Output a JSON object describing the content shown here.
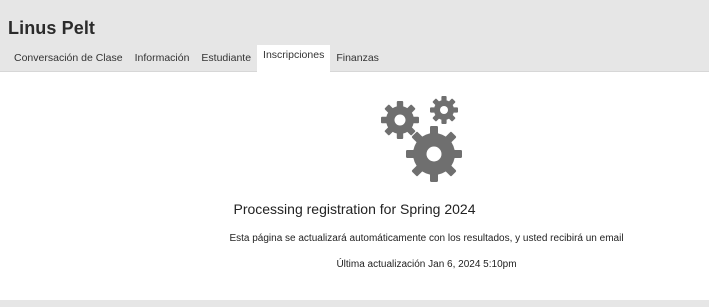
{
  "header": {
    "title": "Linus Pelt"
  },
  "tabs": [
    {
      "label": "Conversación de Clase",
      "active": false
    },
    {
      "label": "Información",
      "active": false
    },
    {
      "label": "Estudiante",
      "active": false
    },
    {
      "label": "Inscripciones",
      "active": true
    },
    {
      "label": "Finanzas",
      "active": false
    }
  ],
  "main": {
    "icon": "gears-icon",
    "heading": "Processing registration for Spring 2024",
    "message": "Esta página se actualizará automáticamente con los resultados, y usted recibirá un email",
    "last_updated": "Última actualización Jan 6, 2024 5:10pm"
  },
  "colors": {
    "header_bg": "#e6e6e6",
    "gear": "#6f6f6f"
  }
}
